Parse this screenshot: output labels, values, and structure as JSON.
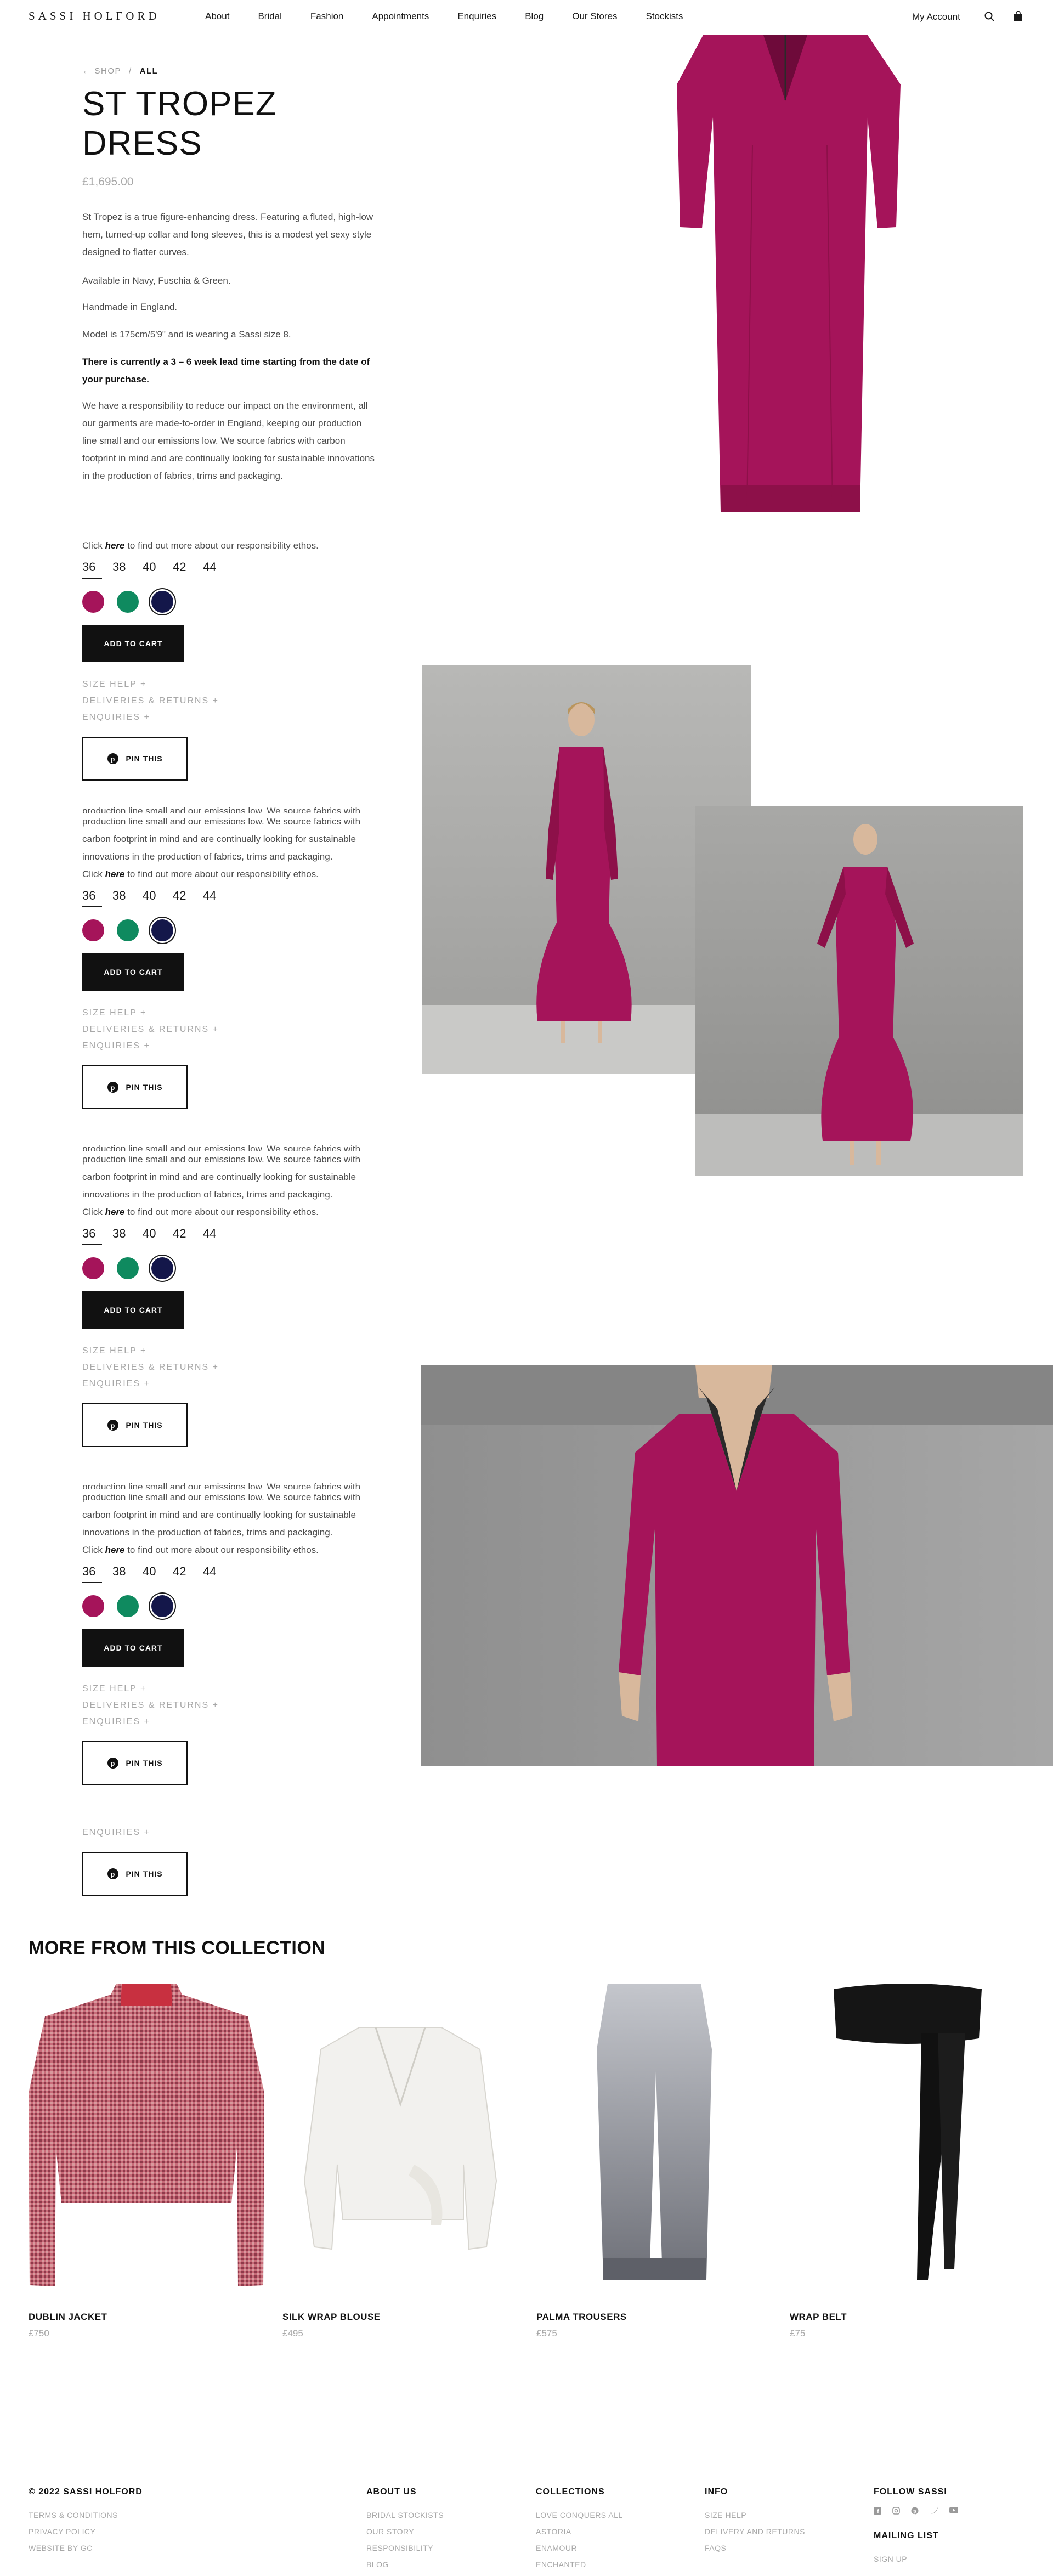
{
  "brand": {
    "logo": "SASSI HOLFORD"
  },
  "nav": [
    "About",
    "Bridal",
    "Fashion",
    "Appointments",
    "Enquiries",
    "Blog",
    "Our Stores",
    "Stockists"
  ],
  "account": {
    "label": "My Account"
  },
  "breadcrumb": {
    "shop": "SHOP",
    "sep": "/",
    "current": "ALL"
  },
  "product": {
    "title": "ST TROPEZ DRESS",
    "price": "£1,695.00",
    "desc1": "St Tropez is a true figure-enhancing dress. Featuring a fluted, high-low hem, turned-up collar and long sleeves, this is a modest yet sexy style designed to flatter curves.",
    "colours_text": "Available in Navy, Fuschia & Green.",
    "handmade": "Handmade in England.",
    "model": "Model is 175cm/5'9\" and is wearing a Sassi size 8.",
    "lead_time": "There is currently a 3 – 6 week lead time starting from the date of your purchase.",
    "responsibility": "We have a responsibility to reduce our impact on the environment, all our garments are made-to-order in England, keeping our production line small and our emissions low. We source fabrics with carbon footprint in mind and are continually looking for sustainable innovations in the production of fabrics, trims and packaging.",
    "repeat_fragment": "production line small and our emissions low. We source fabrics with carbon footprint in mind and are continually looking for sustainable innovations in the production of fabrics, trims and packaging.",
    "click_pre": "Click ",
    "click_here": "here",
    "click_post": " to find out more about our responsibility ethos.",
    "sizes": [
      "36",
      "38",
      "40",
      "42",
      "44"
    ],
    "swatch_colors": [
      "#a5145a",
      "#0f8a5f",
      "#14174a"
    ],
    "add_to_cart": "ADD TO CART",
    "size_help": "SIZE HELP +",
    "deliveries": "DELIVERIES & RETURNS +",
    "enquiries": "ENQUIRIES +",
    "pin": "PIN THIS"
  },
  "collection": {
    "title": "MORE FROM THIS COLLECTION",
    "items": [
      {
        "name": "DUBLIN JACKET",
        "price": "£750"
      },
      {
        "name": "SILK WRAP BLOUSE",
        "price": "£495"
      },
      {
        "name": "PALMA TROUSERS",
        "price": "£575"
      },
      {
        "name": "WRAP BELT",
        "price": "£75"
      }
    ]
  },
  "footer": {
    "copyright": "© 2022 SASSI HOLFORD",
    "legal": [
      "TERMS & CONDITIONS",
      "PRIVACY POLICY",
      "WEBSITE BY GC"
    ],
    "about": {
      "title": "ABOUT US",
      "links": [
        "BRIDAL STOCKISTS",
        "OUR STORY",
        "RESPONSIBILITY",
        "BLOG"
      ]
    },
    "collections": {
      "title": "COLLECTIONS",
      "links": [
        "LOVE CONQUERS ALL",
        "ASTORIA",
        "ENAMOUR",
        "ENCHANTED"
      ]
    },
    "info": {
      "title": "INFO",
      "links": [
        "SIZE HELP",
        "DELIVERY AND RETURNS",
        "FAQS"
      ]
    },
    "follow": {
      "title": "FOLLOW SASSI",
      "icons": [
        "facebook-icon",
        "instagram-icon",
        "pinterest-icon",
        "twitter-icon",
        "youtube-icon"
      ]
    },
    "mailing": {
      "title": "MAILING LIST",
      "signup": "SIGN UP"
    }
  },
  "colors": {
    "fuchsia": "#a5145a",
    "text": "#1a1a1a",
    "muted": "#a8a8a8"
  }
}
